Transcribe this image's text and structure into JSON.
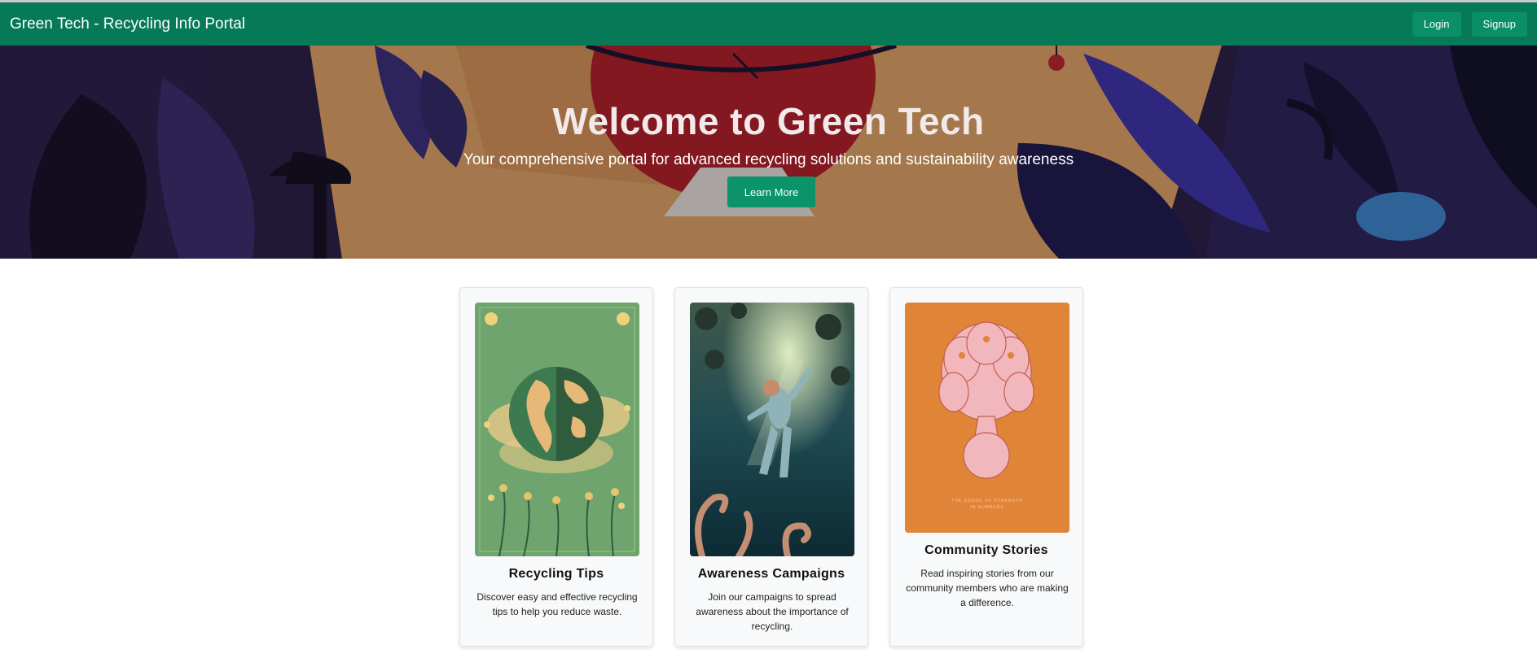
{
  "navbar": {
    "brand": "Green Tech - Recycling Info Portal",
    "login_label": "Login",
    "signup_label": "Signup",
    "color": "#067957"
  },
  "hero": {
    "title": "Welcome to Green Tech",
    "subtitle": "Your comprehensive portal for advanced recycling solutions and sustainability awareness",
    "button_label": "Learn More"
  },
  "cards": [
    {
      "title": "Recycling Tips",
      "text": "Discover easy and effective recycling tips to help you reduce waste.",
      "image_icon": "globe-illustration-icon"
    },
    {
      "title": "Awareness Campaigns",
      "text": "Join our campaigns to spread awareness about the importance of recycling.",
      "image_icon": "diver-illustration-icon"
    },
    {
      "title": "Community Stories",
      "text": "Read inspiring stories from our community members who are making a difference.",
      "image_icon": "community-tree-illustration-icon",
      "image_caption": "THE SOUND OF STRENGTH IN NUMBERS"
    }
  ]
}
